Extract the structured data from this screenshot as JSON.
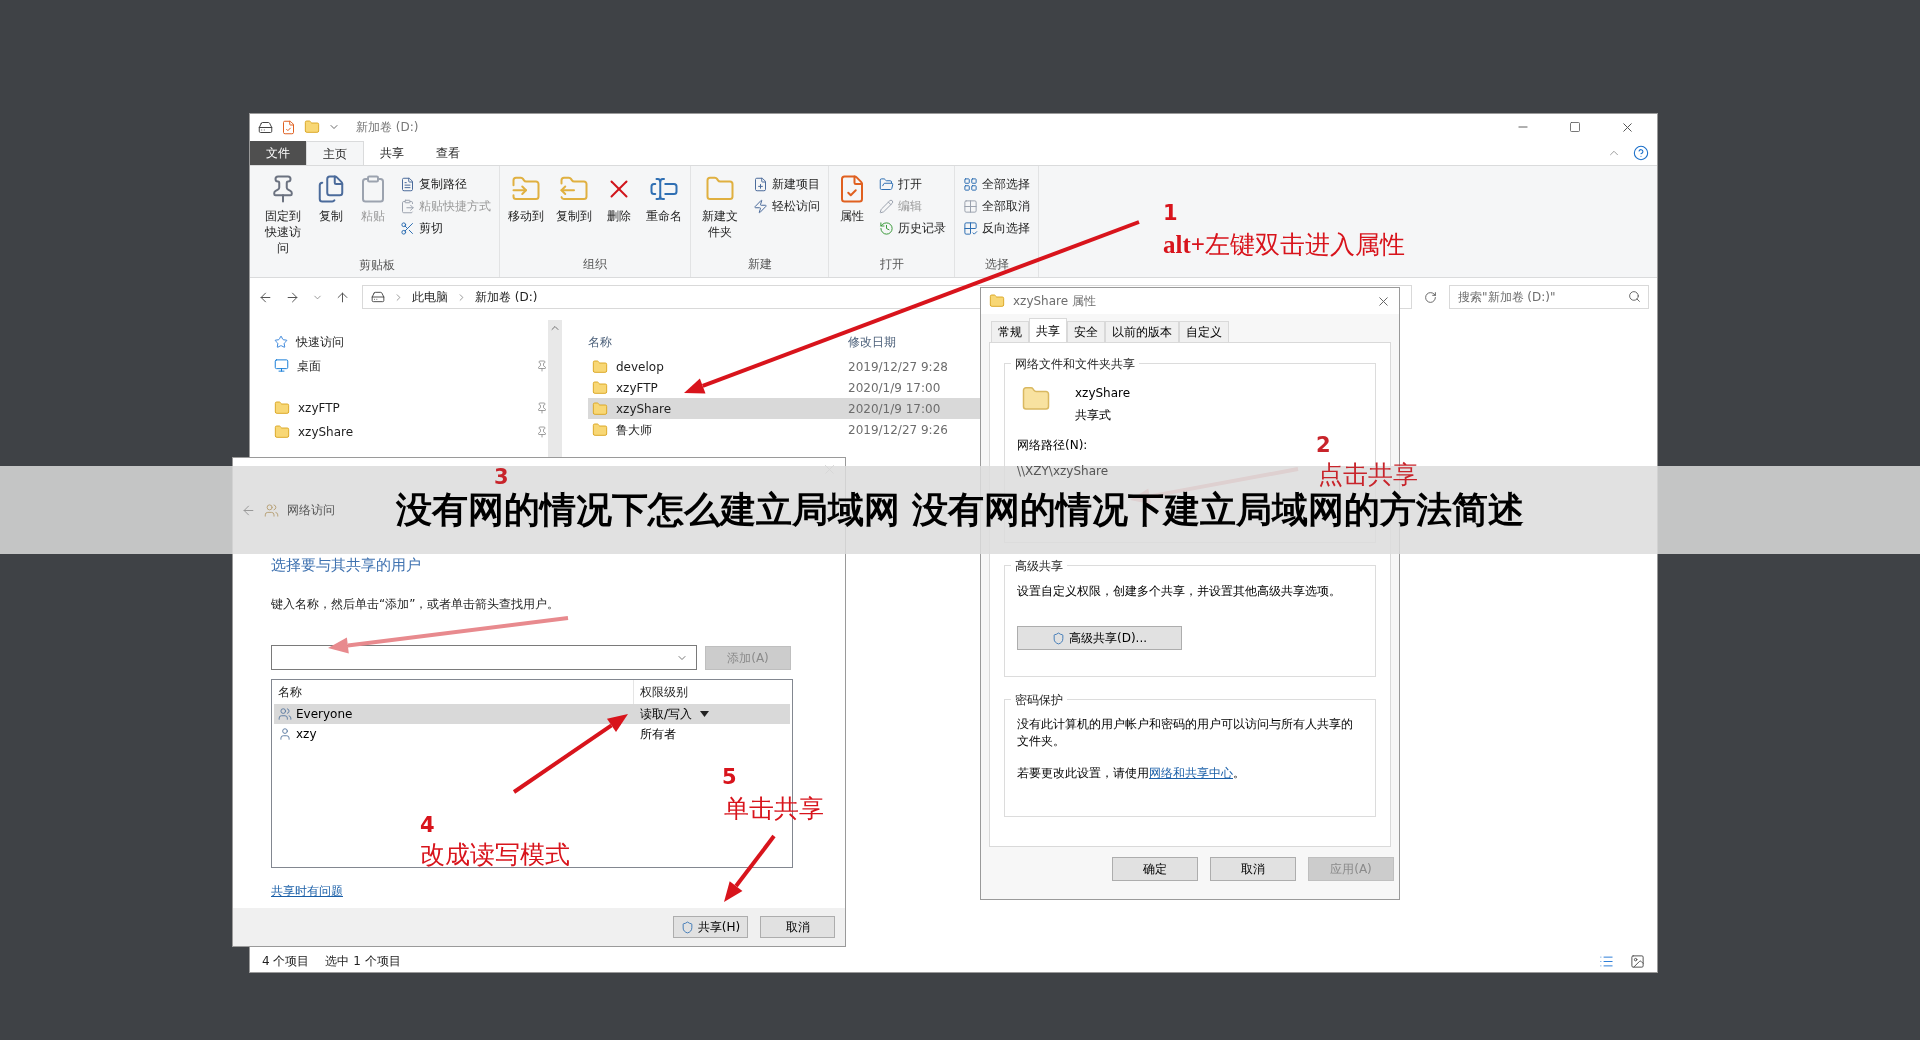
{
  "explorer": {
    "title": "新加卷 (D:)",
    "tabs": [
      {
        "label": "文件",
        "kind": "file",
        "selected": false
      },
      {
        "label": "主页",
        "kind": "tab",
        "selected": true
      },
      {
        "label": "共享",
        "kind": "tab",
        "selected": false
      },
      {
        "label": "查看",
        "kind": "tab",
        "selected": false
      }
    ],
    "ribbon": [
      {
        "name": "剪贴板",
        "items": [
          {
            "label": "固定到快速访问",
            "kind": "large",
            "disabled": false
          },
          {
            "label": "复制",
            "kind": "large",
            "disabled": false
          },
          {
            "label": "粘贴",
            "kind": "large",
            "disabled": true
          },
          {
            "label": "复制路径",
            "kind": "small",
            "disabled": false
          },
          {
            "label": "粘贴快捷方式",
            "kind": "small",
            "disabled": true
          },
          {
            "label": "剪切",
            "kind": "small",
            "disabled": false
          }
        ]
      },
      {
        "name": "组织",
        "items": [
          {
            "label": "移动到",
            "kind": "large",
            "disabled": false
          },
          {
            "label": "复制到",
            "kind": "large",
            "disabled": false
          },
          {
            "label": "删除",
            "kind": "large",
            "disabled": false
          },
          {
            "label": "重命名",
            "kind": "large",
            "disabled": false
          }
        ]
      },
      {
        "name": "新建",
        "items": [
          {
            "label": "新建文件夹",
            "kind": "large",
            "disabled": false
          },
          {
            "label": "新建项目",
            "kind": "small",
            "disabled": false
          },
          {
            "label": "轻松访问",
            "kind": "small",
            "disabled": false
          }
        ]
      },
      {
        "name": "打开",
        "items": [
          {
            "label": "属性",
            "kind": "large",
            "disabled": false
          },
          {
            "label": "打开",
            "kind": "small",
            "disabled": false
          },
          {
            "label": "编辑",
            "kind": "small",
            "disabled": true
          },
          {
            "label": "历史记录",
            "kind": "small",
            "disabled": false
          }
        ]
      },
      {
        "name": "选择",
        "items": [
          {
            "label": "全部选择",
            "kind": "small",
            "disabled": false
          },
          {
            "label": "全部取消",
            "kind": "small",
            "disabled": false
          },
          {
            "label": "反向选择",
            "kind": "small",
            "disabled": false
          }
        ]
      }
    ],
    "breadcrumbs": [
      "此电脑",
      "新加卷 (D:)"
    ],
    "search": {
      "placeholder": "搜索\"新加卷 (D:)\""
    },
    "nav": [
      {
        "label": "快速访问",
        "kind": "header"
      },
      {
        "label": "桌面",
        "kind": "desktop"
      },
      {
        "label": "xzyFTP",
        "kind": "folder"
      },
      {
        "label": "xzyShare",
        "kind": "folder"
      }
    ],
    "columns": [
      "名称",
      "修改日期"
    ],
    "rows": [
      {
        "name": "develop",
        "date": "2019/12/27 9:28",
        "selected": false
      },
      {
        "name": "xzyFTP",
        "date": "2020/1/9 17:00",
        "selected": false
      },
      {
        "name": "xzyShare",
        "date": "2020/1/9 17:00",
        "selected": true
      },
      {
        "name": "鲁大师",
        "date": "2019/12/27 9:26",
        "selected": false
      }
    ],
    "status": [
      "4 个项目",
      "选中 1 个项目"
    ]
  },
  "share_dialog": {
    "title": "网络访问",
    "heading": "选择要与其共享的用户",
    "instruction": "键入名称，然后单击“添加”，或者单击箭头查找用户。",
    "add_button": {
      "label": "添加(A)",
      "disabled": true
    },
    "columns": [
      "名称",
      "权限级别"
    ],
    "users": [
      {
        "name": "Everyone",
        "kind": "group",
        "permission": "读取/写入",
        "dropdown": true,
        "selected": true
      },
      {
        "name": "xzy",
        "kind": "user",
        "permission": "所有者",
        "dropdown": false,
        "selected": false
      }
    ],
    "help_link": "共享时有问题",
    "buttons": [
      {
        "label": "共享(H)",
        "shield": true
      },
      {
        "label": "取消",
        "shield": false
      }
    ]
  },
  "properties_dialog": {
    "title": "xzyShare 属性",
    "tabs": [
      {
        "label": "常规",
        "selected": false
      },
      {
        "label": "共享",
        "selected": true
      },
      {
        "label": "安全",
        "selected": false
      },
      {
        "label": "以前的版本",
        "selected": false
      },
      {
        "label": "自定义",
        "selected": false
      }
    ],
    "share_group": "网络文件和文件夹共享",
    "folder_name": "xzyShare",
    "folder_state": "共享式",
    "path_label": "网络路径(N):",
    "path": "\\\\XZY\\xzyShare",
    "advanced_group": "高级共享",
    "advanced_text": "设置自定义权限，创建多个共享，并设置其他高级共享选项。",
    "advanced_button": "高级共享(D)...",
    "password_group": "密码保护",
    "password_text": "没有此计算机的用户帐户和密码的用户可以访问与所有人共享的文件夹。",
    "change_before": "若要更改此设置，请使用",
    "change_link": "网络和共享中心",
    "change_after": "。",
    "buttons": [
      {
        "label": "确定",
        "disabled": false
      },
      {
        "label": "取消",
        "disabled": false
      },
      {
        "label": "应用(A)",
        "disabled": true
      }
    ]
  },
  "annotations": [
    {
      "number": "1",
      "text": "**alt+**左键双击进入属性"
    },
    {
      "number": "3"
    },
    {
      "number": "2",
      "text": "点击共享"
    },
    {
      "number": "4",
      "text": "改成读写模式"
    },
    {
      "number": "5",
      "text": "单击共享"
    }
  ],
  "banner": {
    "title": "没有网的情况下怎么建立局域网 没有网的情况下建立局域网的方法简述"
  }
}
